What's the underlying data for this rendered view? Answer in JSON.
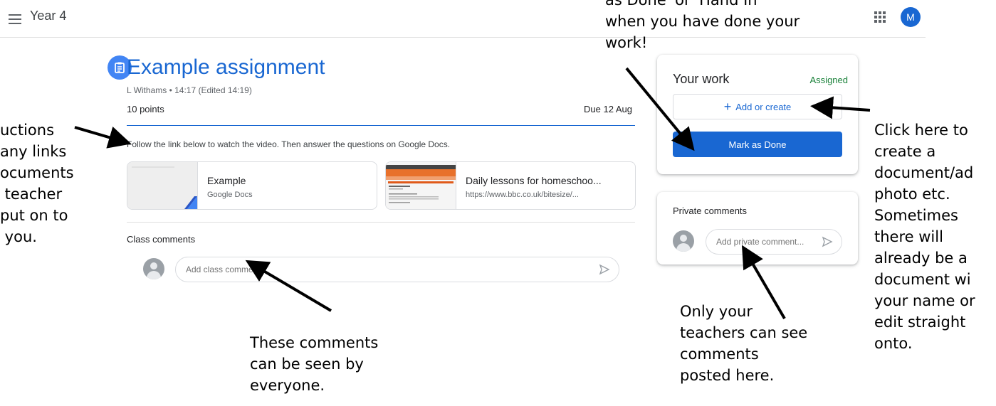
{
  "topbar": {
    "class_name": "Year 4",
    "avatar_initial": "M",
    "menu_icon": "hamburger-menu-icon",
    "apps_icon": "apps-grid-icon"
  },
  "assignment": {
    "icon": "assignment-icon",
    "title": "Example assignment",
    "meta": "L Withams • 14:17 (Edited 14:19)",
    "points": "10 points",
    "due": "Due 12 Aug",
    "instructions": "Follow the link below to watch the video. Then answer the questions on Google Docs."
  },
  "attachments": [
    {
      "title": "Example",
      "subtitle": "Google Docs"
    },
    {
      "title": "Daily lessons for homeschoo...",
      "subtitle": "https://www.bbc.co.uk/bitesize/..."
    }
  ],
  "class_comments": {
    "label": "Class comments",
    "placeholder": "Add class comment"
  },
  "your_work": {
    "title": "Your work",
    "status": "Assigned",
    "add_label": "Add or create",
    "mark_done_label": "Mark as Done"
  },
  "private_comments": {
    "label": "Private comments",
    "placeholder": "Add private comment..."
  },
  "annotations": {
    "left": "uctions\nany links\nocuments\n teacher\nput on to\n you.",
    "top": "as Done' or 'Hand In'\nwhen you have done your\nwork!",
    "class_comments_note": "These comments\ncan be seen by\neveryone.",
    "private_note": "Only your\nteachers can see\ncomments\nposted here.",
    "right": "Click here to\ncreate a\ndocument/ad\nphoto etc.\nSometimes\nthere will\nalready be a\ndocument wi\nyour name or\nedit straight\nonto."
  },
  "colors": {
    "accent": "#1967d2",
    "assigned": "#188038",
    "divider": "#e0e0e0"
  }
}
